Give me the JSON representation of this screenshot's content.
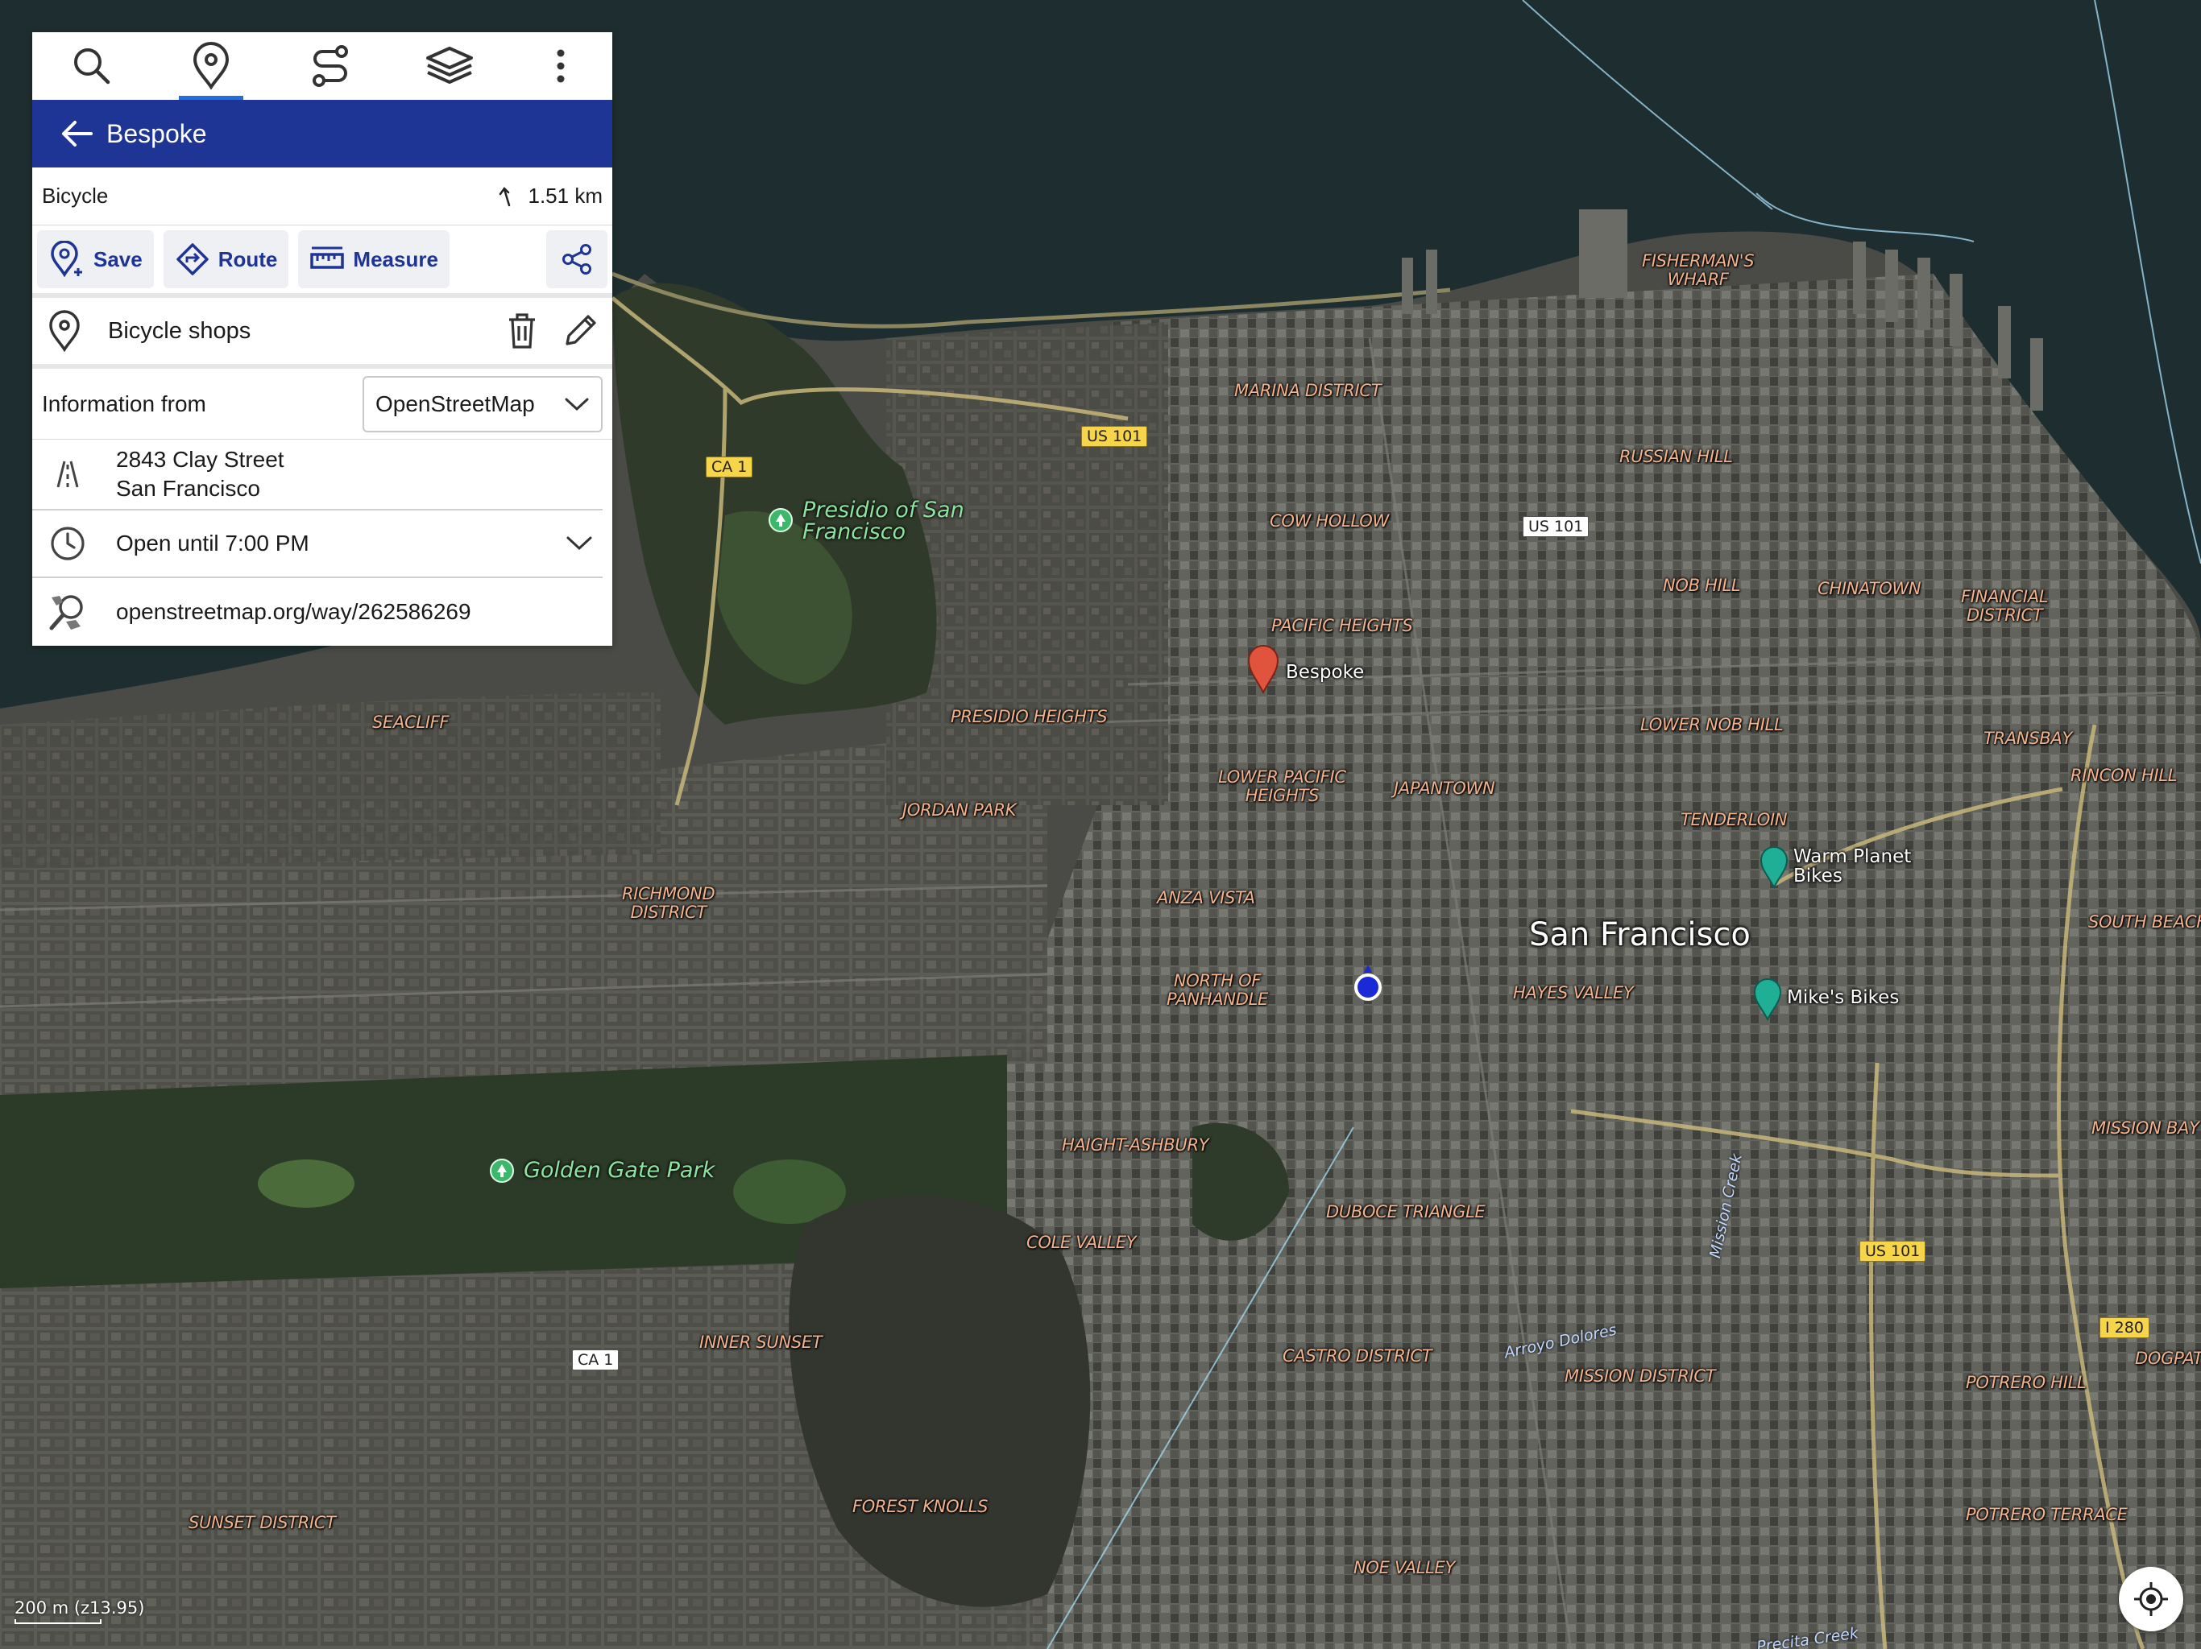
{
  "toolbar": {
    "items": [
      {
        "icon": "search-icon"
      },
      {
        "icon": "map-pin-icon",
        "active": true
      },
      {
        "icon": "route-icon"
      },
      {
        "icon": "layers-icon"
      },
      {
        "icon": "more-vertical-icon"
      }
    ]
  },
  "header": {
    "title": "Bespoke"
  },
  "place": {
    "type": "Bicycle",
    "distance": "1.51 km"
  },
  "actions": {
    "save": "Save",
    "route": "Route",
    "measure": "Measure"
  },
  "category": {
    "label": "Bicycle shops"
  },
  "info": {
    "label": "Information from",
    "source": "OpenStreetMap"
  },
  "details": {
    "address_line1": "2843 Clay Street",
    "address_line2": "San Francisco",
    "hours": "Open until 7:00 PM",
    "url": "openstreetmap.org/way/262586269"
  },
  "map": {
    "city": "San Francisco",
    "districts": [
      "FISHERMAN'S\nWHARF",
      "MARINA DISTRICT",
      "RUSSIAN HILL",
      "COW HOLLOW",
      "NOB HILL",
      "CHINATOWN",
      "FINANCIAL\nDISTRICT",
      "PACIFIC HEIGHTS",
      "PRESIDIO HEIGHTS",
      "LOWER NOB HILL",
      "SEACLIFF",
      "TRANSBAY",
      "LOWER PACIFIC\nHEIGHTS",
      "JAPANTOWN",
      "RINCON HILL",
      "JORDAN PARK",
      "TENDERLOIN",
      "RICHMOND\nDISTRICT",
      "ANZA VISTA",
      "SOUTH BEACH",
      "NORTH OF\nPANHANDLE",
      "HAYES VALLEY",
      "MISSION BAY",
      "HAIGHT-ASHBURY",
      "DUBOCE TRIANGLE",
      "COLE VALLEY",
      "INNER SUNSET",
      "CASTRO DISTRICT",
      "MISSION DISTRICT",
      "POTRERO HILL",
      "DOGPATCH",
      "FOREST KNOLLS",
      "SUNSET DISTRICT",
      "POTRERO TERRACE",
      "NOE VALLEY"
    ],
    "parks": [
      "Presidio of San\nFrancisco",
      "Golden Gate Park"
    ],
    "shields": [
      "CA 1",
      "US 101",
      "US 101",
      "US 101",
      "CA 1",
      "I 280"
    ],
    "creeks": [
      "Mission Creek",
      "Arroyo Dolores",
      "Precita Creek"
    ],
    "pois": [
      {
        "label": "Bespoke",
        "color": "#e0533c"
      },
      {
        "label": "Warm Planet\nBikes",
        "color": "#1fae96"
      },
      {
        "label": "Mike's Bikes",
        "color": "#1fae96"
      }
    ],
    "scale": "200 m  (z13.95)"
  },
  "colors": {
    "header_bg": "#1f3595",
    "accent": "#1f6fe0",
    "water": "#1e2e30",
    "land": "#4a4b47"
  }
}
